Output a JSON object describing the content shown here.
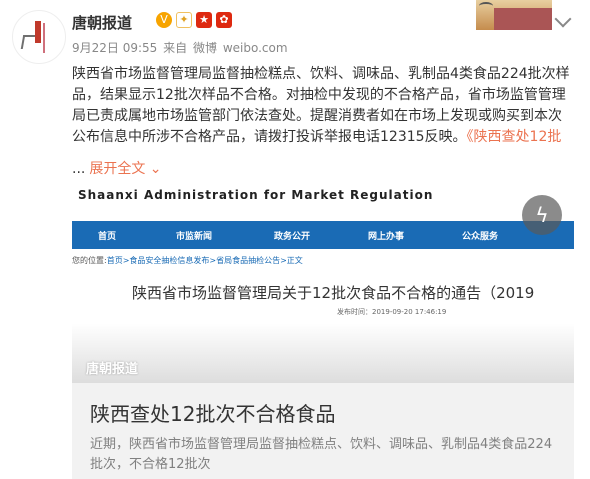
{
  "post": {
    "author": "唐朝报道",
    "date": "9月22日 09:55",
    "source_prefix": "来自",
    "source": "微博",
    "domain": "weibo.com",
    "text": "陕西省市场监督管理局监督抽检糕点、饮料、调味品、乳制品4类食品224批次样品，结果显示12批次样品不合格。对抽检中发现的不合格产品，省市场监管管理局已责成属地市场监管部门依法查处。提醒消费者如在市场上发现或购买到本次公布信息中所涉不合格产品，请拨打投诉举报电话12315反映。",
    "link_text": "《陕西查处12批",
    "ellipsis": "...",
    "expand": "展开全文 ⌄",
    "icons": {
      "verified": "verified-v-icon",
      "fans": "fan-badge-icon",
      "flag_cn": "china-flag-icon",
      "flag_hk": "hongkong-flag-icon",
      "more": "chevron-down-icon",
      "flash": "lightning-icon"
    }
  },
  "card": {
    "org_en": "Shaanxi  Administration for Market Regulation",
    "nav": [
      "首页",
      "市监新闻",
      "政务公开",
      "网上办事",
      "公众服务"
    ],
    "crumb_prefix": "您的位置:",
    "crumb_path": "首页>食品安全抽检信息发布>省局食品抽检公告>正文",
    "notice_title": "陕西省市场监督管理局关于12批次食品不合格的通告（2019",
    "publish_time": "发布时间：2019-09-20 17:46:19",
    "watermark": "唐朝报道",
    "headline": "陕西查处12批次不合格食品",
    "desc": "近期，陕西省市场监督管理局监督抽检糕点、饮料、调味品、乳制品4类食品224批次，不合格12批次"
  },
  "colors": {
    "accent": "#eb7350",
    "nav": "#1a6bb5"
  }
}
